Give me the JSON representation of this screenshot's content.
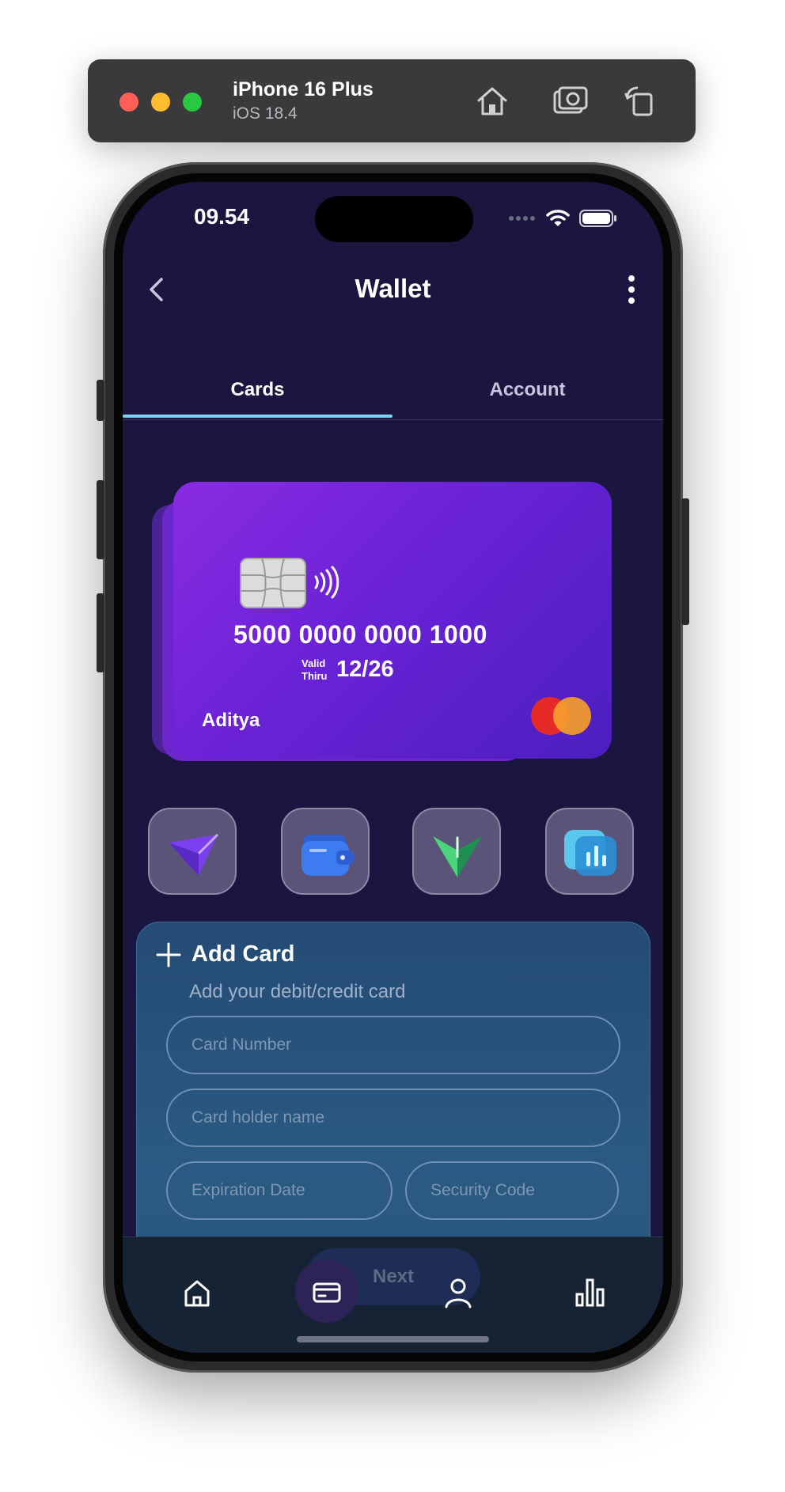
{
  "simulator": {
    "device_name": "iPhone 16 Plus",
    "os_version": "iOS 18.4",
    "buttons": [
      "home-icon",
      "screenshot-icon",
      "rotate-icon"
    ]
  },
  "status_bar": {
    "time": "09.54"
  },
  "header": {
    "title": "Wallet",
    "back_icon": "chevron-left-icon",
    "more_icon": "more-vertical-icon"
  },
  "tabs": [
    {
      "label": "Cards",
      "active": true
    },
    {
      "label": "Account",
      "active": false
    }
  ],
  "card": {
    "number": "5000 0000 0000 1000",
    "valid_label_line1": "Valid",
    "valid_label_line2": "Thiru",
    "expiry": "12/26",
    "holder": "Aditya",
    "network_icon": "mastercard-logo",
    "gradient": [
      "#8a2be2",
      "#4b1fbf"
    ]
  },
  "quick_actions": [
    {
      "icon": "send-icon"
    },
    {
      "icon": "wallet-icon"
    },
    {
      "icon": "vpn-icon"
    },
    {
      "icon": "analytics-icon"
    }
  ],
  "add_card": {
    "title": "Add Card",
    "subtitle": "Add your debit/credit card",
    "card_number_placeholder": "Card Number",
    "holder_placeholder": "Card holder name",
    "expiry_placeholder": "Expiration Date",
    "security_placeholder": "Security Code",
    "next_label": "Next"
  },
  "bottom_nav": {
    "items": [
      "home-icon",
      "card-icon",
      "profile-icon",
      "chart-icon"
    ],
    "active_index": 1
  },
  "colors": {
    "background": "#1b1640",
    "accent": "#7dd3f0",
    "panel": "#244b74"
  }
}
